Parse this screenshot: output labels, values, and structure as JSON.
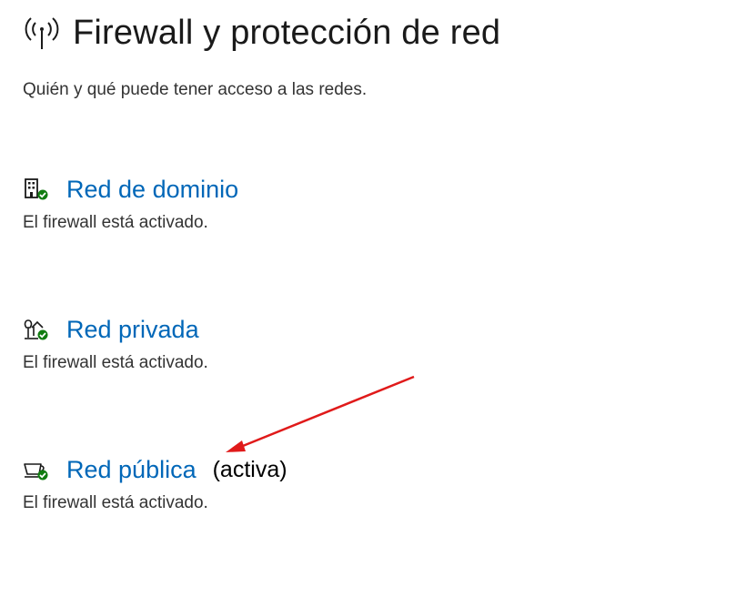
{
  "header": {
    "icon": "wifi-antenna-icon",
    "title": "Firewall y protección de red",
    "subtitle": "Quién y qué puede tener acceso a las redes."
  },
  "networks": [
    {
      "icon": "building-shield-icon",
      "label": "Red de dominio",
      "active_label": "",
      "status": "El firewall está activado."
    },
    {
      "icon": "house-shield-icon",
      "label": "Red privada",
      "active_label": "",
      "status": "El firewall está activado."
    },
    {
      "icon": "coffee-cup-shield-icon",
      "label": "Red pública",
      "active_label": "(activa)",
      "status": "El firewall está activado."
    }
  ],
  "colors": {
    "link": "#0067b8",
    "check_green": "#107c10",
    "annotation_arrow": "#e01a1a"
  }
}
